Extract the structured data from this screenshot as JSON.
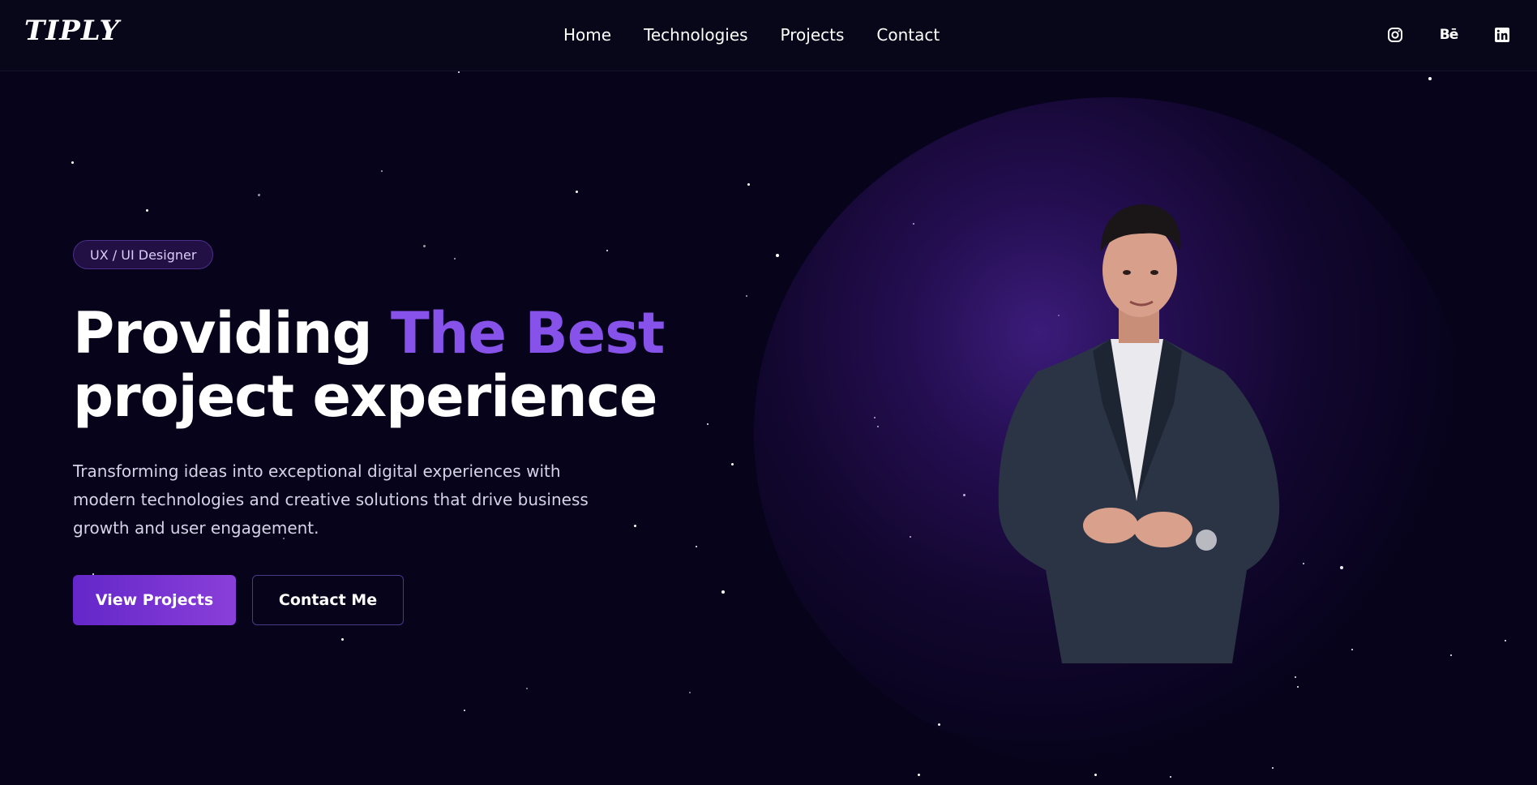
{
  "header": {
    "logo": "TIPLY",
    "nav": [
      {
        "label": "Home"
      },
      {
        "label": "Technologies"
      },
      {
        "label": "Projects"
      },
      {
        "label": "Contact"
      }
    ],
    "socials": [
      {
        "icon": "instagram-icon"
      },
      {
        "icon": "behance-icon",
        "label": "Bē"
      },
      {
        "icon": "linkedin-icon"
      }
    ]
  },
  "hero": {
    "badge": "UX / UI Designer",
    "headline": {
      "part1": "Providing ",
      "accent": "The Best",
      "part2": "project experience"
    },
    "description": "Transforming ideas into exceptional digital experiences with modern technologies and creative solutions that drive business growth and user engagement.",
    "primary_button": "View Projects",
    "secondary_button": "Contact Me"
  },
  "colors": {
    "background": "#06031a",
    "accent": "#8752ea",
    "primary_button": "#6427c9"
  }
}
